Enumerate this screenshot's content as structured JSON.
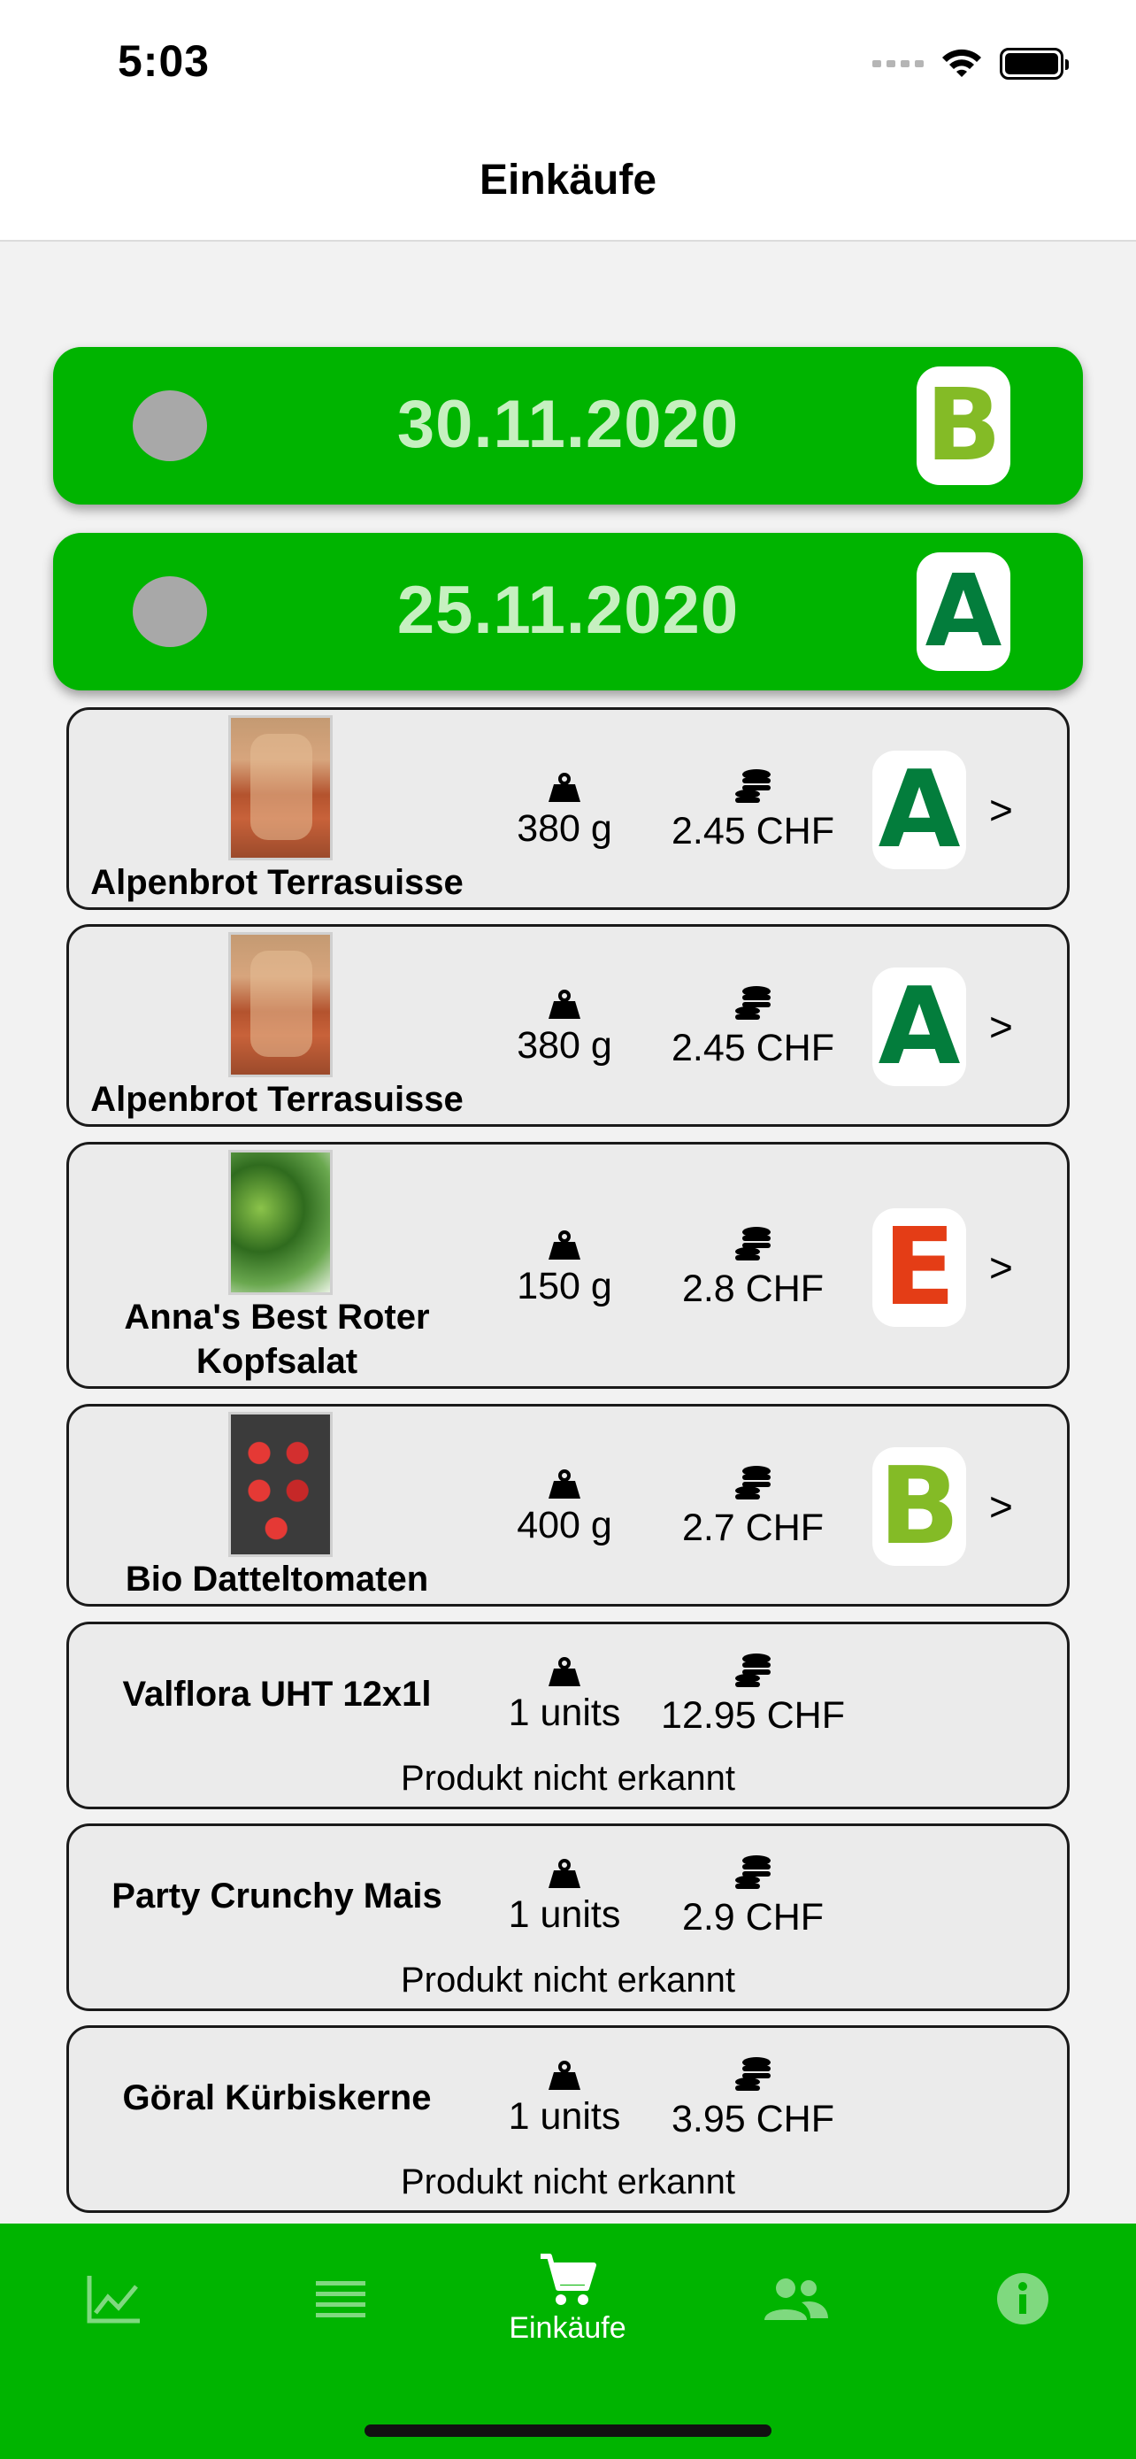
{
  "status": {
    "time": "5:03"
  },
  "nav": {
    "title": "Einkäufe"
  },
  "purchases": [
    {
      "date": "30.11.2020",
      "grade": "B",
      "grade_color": "#84bb26"
    },
    {
      "date": "25.11.2020",
      "grade": "A",
      "grade_color": "#037d3c"
    }
  ],
  "items": [
    {
      "name": "Alpenbrot Terrasuisse",
      "weight": "380 g",
      "price": "2.45 CHF",
      "grade": "A",
      "image": "bread"
    },
    {
      "name": "Alpenbrot Terrasuisse",
      "weight": "380 g",
      "price": "2.45 CHF",
      "grade": "A",
      "image": "bread"
    },
    {
      "name_line1": "Anna's Best Roter",
      "name_line2": "Kopfsalat",
      "weight": "150 g",
      "price": "2.8 CHF",
      "grade": "E",
      "image": "salad"
    },
    {
      "name": "Bio Datteltomaten",
      "weight": "400 g",
      "price": "2.7 CHF",
      "grade": "B",
      "image": "tomato"
    },
    {
      "name": "Valflora UHT 12x1l",
      "weight": "1 units",
      "price": "12.95 CHF",
      "status": "Produkt nicht erkannt"
    },
    {
      "name": "Party Crunchy Mais",
      "weight": "1 units",
      "price": "2.9 CHF",
      "status": "Produkt nicht erkannt"
    },
    {
      "name": "Göral Kürbiskerne",
      "weight": "1 units",
      "price": "3.95 CHF",
      "status": "Produkt nicht erkannt"
    }
  ],
  "tabs": [
    {
      "icon": "chart-icon",
      "label": ""
    },
    {
      "icon": "list-icon",
      "label": ""
    },
    {
      "icon": "cart-icon",
      "label": "Einkäufe",
      "active": true
    },
    {
      "icon": "people-icon",
      "label": ""
    },
    {
      "icon": "info-icon",
      "label": ""
    }
  ],
  "colors": {
    "brand_green": "#00b400",
    "grade_A": "#037d3c",
    "grade_B": "#84bb26",
    "grade_E": "#e43d16"
  }
}
